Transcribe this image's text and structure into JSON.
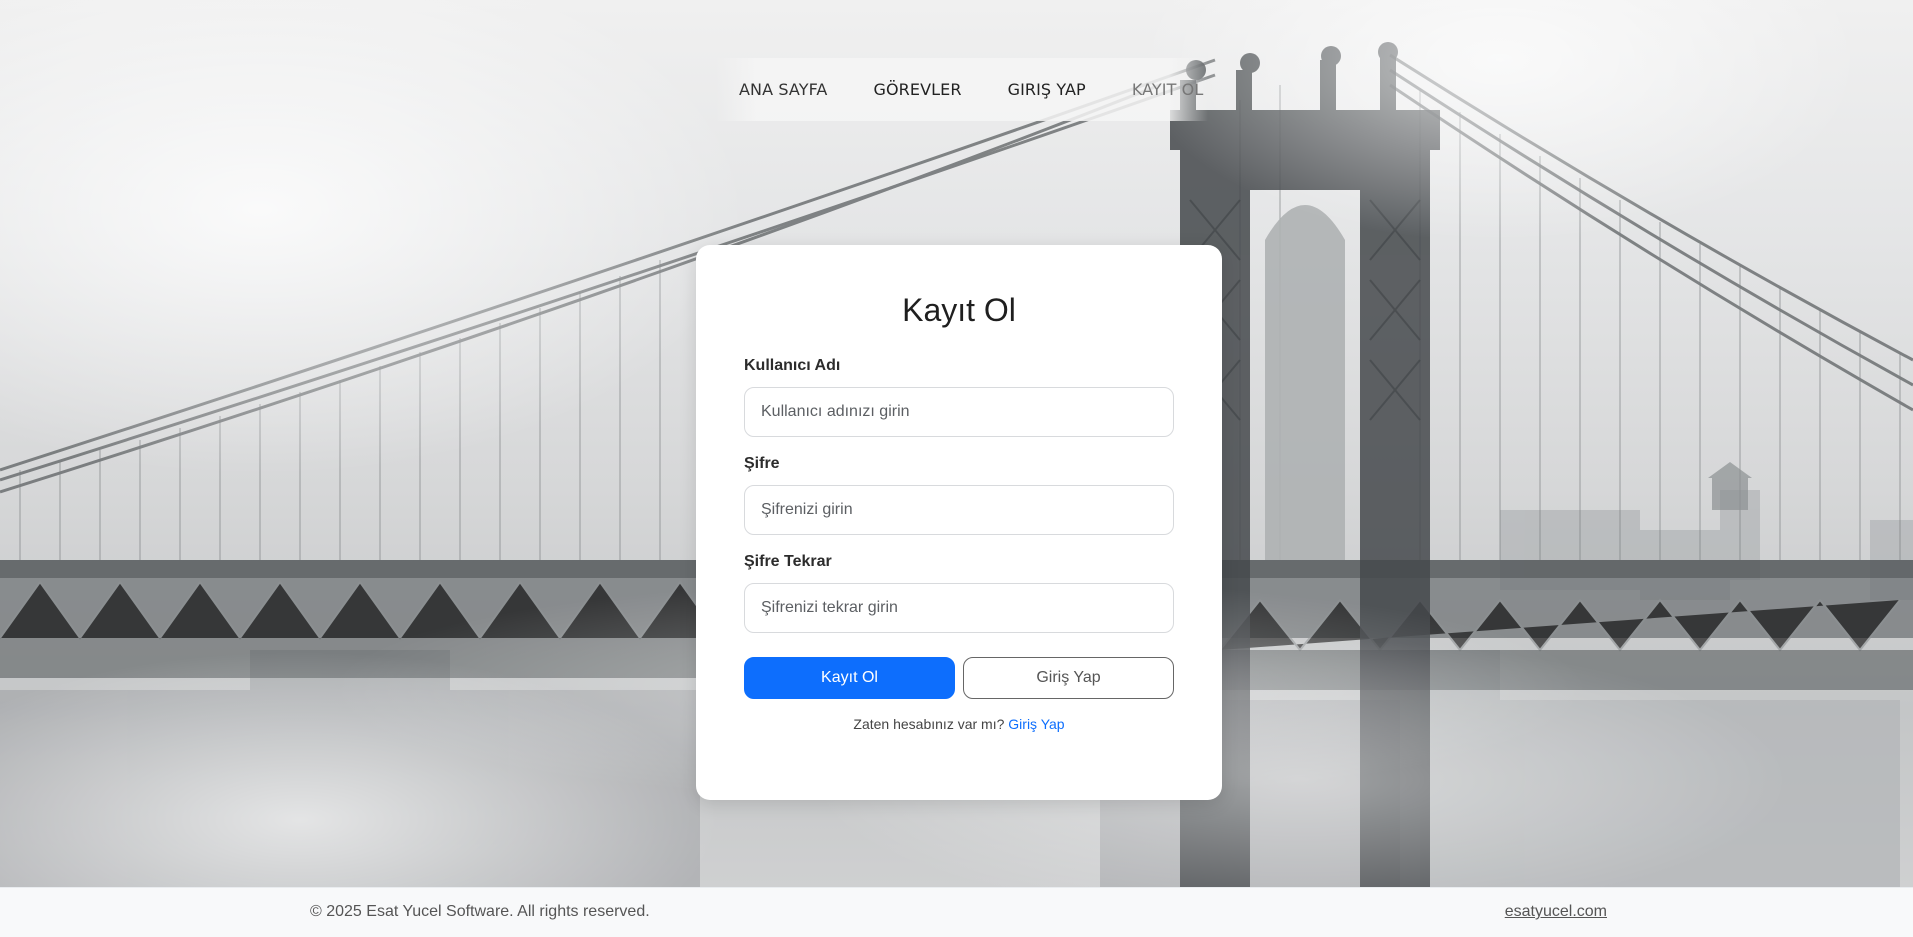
{
  "nav": {
    "items": [
      {
        "label": "ANA SAYFA"
      },
      {
        "label": "GÖREVLER"
      },
      {
        "label": "GIRIŞ YAP"
      },
      {
        "label": "KAYIT OL"
      }
    ]
  },
  "form": {
    "title": "Kayıt Ol",
    "username": {
      "label": "Kullanıcı Adı",
      "placeholder": "Kullanıcı adınızı girin",
      "value": ""
    },
    "password": {
      "label": "Şifre",
      "placeholder": "Şifrenizi girin",
      "value": ""
    },
    "password_repeat": {
      "label": "Şifre Tekrar",
      "placeholder": "Şifrenizi tekrar girin",
      "value": ""
    },
    "submit_label": "Kayıt Ol",
    "login_button_label": "Giriş Yap",
    "switch_prompt": "Zaten hesabınız var mı?",
    "switch_link": "Giriş Yap"
  },
  "footer": {
    "copyright": "© 2025 Esat Yucel Software. All rights reserved.",
    "site_link": "esatyucel.com"
  },
  "colors": {
    "primary": "#0d6efd",
    "footer_bg": "#f8f9fa",
    "card_bg": "#ffffff"
  },
  "background": {
    "scene": "foggy-suspension-bridge"
  }
}
